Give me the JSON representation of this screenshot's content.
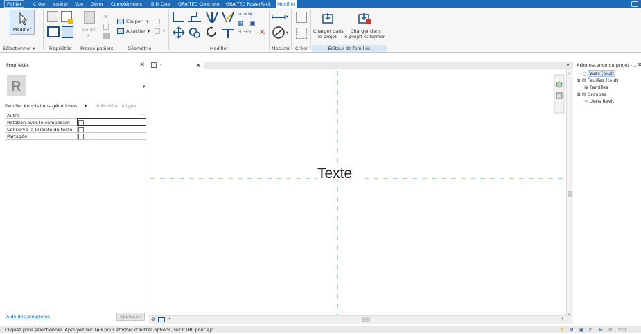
{
  "menu": {
    "items": [
      {
        "label": "Fichier",
        "active_style": "file"
      },
      {
        "label": "Créer"
      },
      {
        "label": "Insérer"
      },
      {
        "label": "Vue"
      },
      {
        "label": "Gérer"
      },
      {
        "label": "Compléments"
      },
      {
        "label": "BIM One"
      },
      {
        "label": "GRAITEC Concrete"
      },
      {
        "label": "GRAITEC PowerPack"
      },
      {
        "label": "Modifier",
        "active": true
      }
    ]
  },
  "ribbon": {
    "modifier_button": "Modifier",
    "coller_button": "Coller",
    "couper_button": "Couper",
    "attacher_button": "Attacher",
    "charger_projet": {
      "line1": "Charger dans",
      "line2": "le projet"
    },
    "charger_fermer": {
      "line1": "Charger dans",
      "line2": "le projet et fermer"
    },
    "panels": {
      "selectionner": "Sélectionner",
      "proprietes": "Propriétés",
      "presse_papiers": "Presse-papiers",
      "geometrie": "Géométrie",
      "modifier": "Modifier",
      "mesurer": "Mesurer",
      "creer": "Créer",
      "editeur": "Editeur de familles"
    }
  },
  "properties": {
    "title": "Propriétés",
    "family": "Famille: Annotations génériques",
    "edit_type": "Modifier le type",
    "group": "Autre",
    "rows": [
      {
        "label": "Rotation avec le composant"
      },
      {
        "label": "Conserve la lisibilité du texte"
      },
      {
        "label": "Partagée"
      }
    ],
    "help_link": "Aide des propriétés",
    "apply": "Appliquer"
  },
  "view_tab": {
    "label": "-"
  },
  "canvas": {
    "text": "Texte"
  },
  "browser": {
    "title": "Arborescence du projet -...",
    "items": [
      {
        "label": "Vues (tout)"
      },
      {
        "label": "Feuilles (tout)"
      },
      {
        "label": "Familles"
      },
      {
        "label": "Groupes"
      },
      {
        "label": "Liens Revit"
      }
    ]
  },
  "status": {
    "message": "Cliquez pour sélectionner. Appuyez sur TAB pour afficher d'autres options, sur CTRL pour ajc",
    "filter_count": ":0"
  },
  "colors": {
    "accent": "#1e6cb7",
    "editor_panel": "#d9e6f5",
    "guide_line": "#5fb85f"
  }
}
